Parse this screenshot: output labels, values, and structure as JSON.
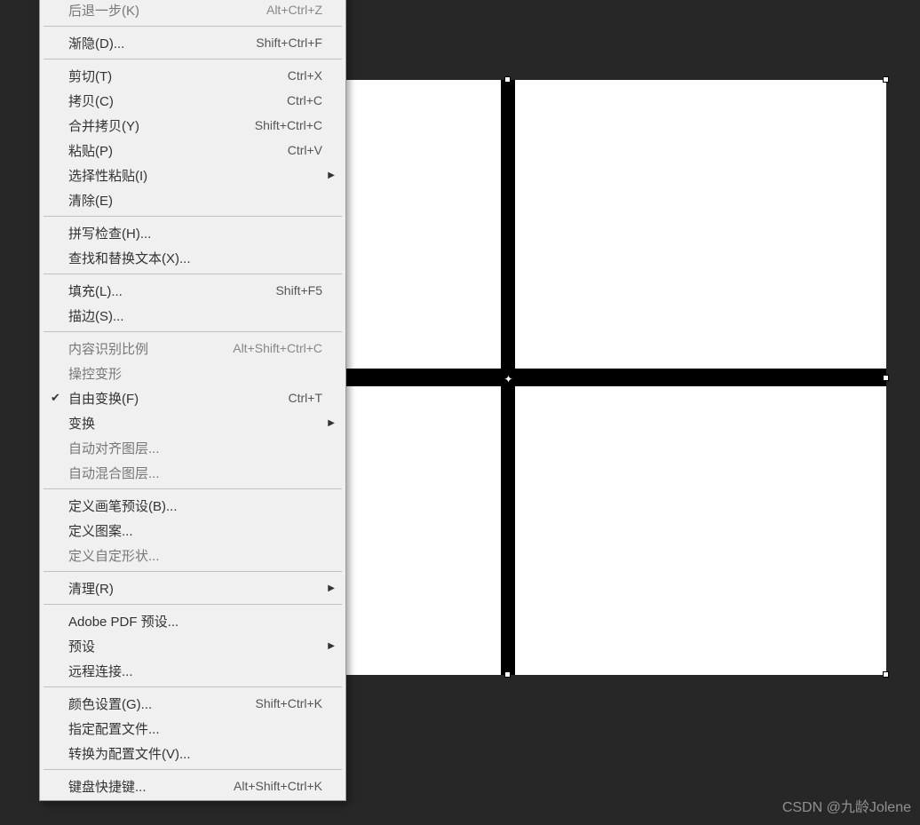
{
  "menu": {
    "sections": [
      [
        {
          "id": "step-back",
          "label": "后退一步(K)",
          "shortcut": "Alt+Ctrl+Z",
          "disabled": true
        }
      ],
      [
        {
          "id": "fade",
          "label": "渐隐(D)...",
          "shortcut": "Shift+Ctrl+F",
          "disabled": false
        }
      ],
      [
        {
          "id": "cut",
          "label": "剪切(T)",
          "shortcut": "Ctrl+X"
        },
        {
          "id": "copy",
          "label": "拷贝(C)",
          "shortcut": "Ctrl+C"
        },
        {
          "id": "copy-merged",
          "label": "合并拷贝(Y)",
          "shortcut": "Shift+Ctrl+C"
        },
        {
          "id": "paste",
          "label": "粘贴(P)",
          "shortcut": "Ctrl+V"
        },
        {
          "id": "paste-special",
          "label": "选择性粘贴(I)",
          "submenu": true
        },
        {
          "id": "clear",
          "label": "清除(E)"
        }
      ],
      [
        {
          "id": "spell-check",
          "label": "拼写检查(H)..."
        },
        {
          "id": "find-replace",
          "label": "查找和替换文本(X)..."
        }
      ],
      [
        {
          "id": "fill",
          "label": "填充(L)...",
          "shortcut": "Shift+F5"
        },
        {
          "id": "stroke",
          "label": "描边(S)..."
        }
      ],
      [
        {
          "id": "content-aware-scale",
          "label": "内容识别比例",
          "shortcut": "Alt+Shift+Ctrl+C",
          "disabled": true
        },
        {
          "id": "puppet-warp",
          "label": "操控变形",
          "disabled": true
        },
        {
          "id": "free-transform",
          "label": "自由变换(F)",
          "shortcut": "Ctrl+T",
          "checked": true
        },
        {
          "id": "transform",
          "label": "变换",
          "submenu": true
        },
        {
          "id": "auto-align",
          "label": "自动对齐图层...",
          "disabled": true
        },
        {
          "id": "auto-blend",
          "label": "自动混合图层...",
          "disabled": true
        }
      ],
      [
        {
          "id": "define-brush",
          "label": "定义画笔预设(B)..."
        },
        {
          "id": "define-pattern",
          "label": "定义图案..."
        },
        {
          "id": "define-shape",
          "label": "定义自定形状...",
          "disabled": true
        }
      ],
      [
        {
          "id": "purge",
          "label": "清理(R)",
          "submenu": true
        }
      ],
      [
        {
          "id": "pdf-presets",
          "label": "Adobe PDF 预设..."
        },
        {
          "id": "presets",
          "label": "预设",
          "submenu": true
        },
        {
          "id": "remote-connect",
          "label": "远程连接..."
        }
      ],
      [
        {
          "id": "color-settings",
          "label": "颜色设置(G)...",
          "shortcut": "Shift+Ctrl+K"
        },
        {
          "id": "assign-profile",
          "label": "指定配置文件..."
        },
        {
          "id": "convert-profile",
          "label": "转换为配置文件(V)..."
        }
      ],
      [
        {
          "id": "keyboard-shortcuts",
          "label": "键盘快捷键...",
          "shortcut": "Alt+Shift+Ctrl+K"
        }
      ]
    ]
  },
  "watermark": "CSDN @九龄Jolene"
}
